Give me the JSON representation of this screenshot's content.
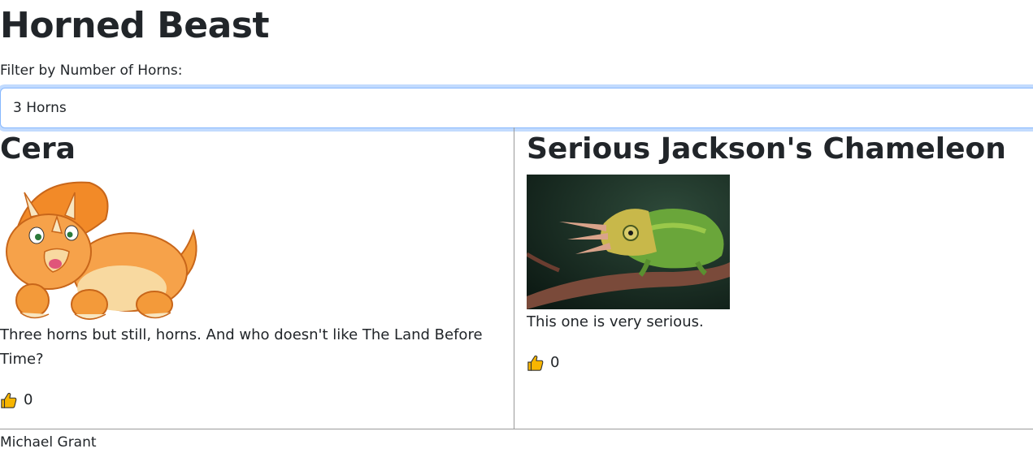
{
  "header": {
    "title": "Horned Beast"
  },
  "filter": {
    "label": "Filter by Number of Horns:",
    "selected": "3 Horns"
  },
  "beasts": [
    {
      "title": "Cera",
      "description": "Three horns but still, horns. And who doesn't like The Land Before Time?",
      "votes": "0",
      "image_icon": "orange-triceratops-cartoon-image"
    },
    {
      "title": "Serious Jackson's Chameleon",
      "description": "This one is very serious.",
      "votes": "0",
      "image_icon": "green-chameleon-photo"
    }
  ],
  "footer": {
    "author": "Michael Grant"
  },
  "colors": {
    "focus_border": "#86b7fe",
    "text": "#212529",
    "thumb": "#f7b500"
  }
}
